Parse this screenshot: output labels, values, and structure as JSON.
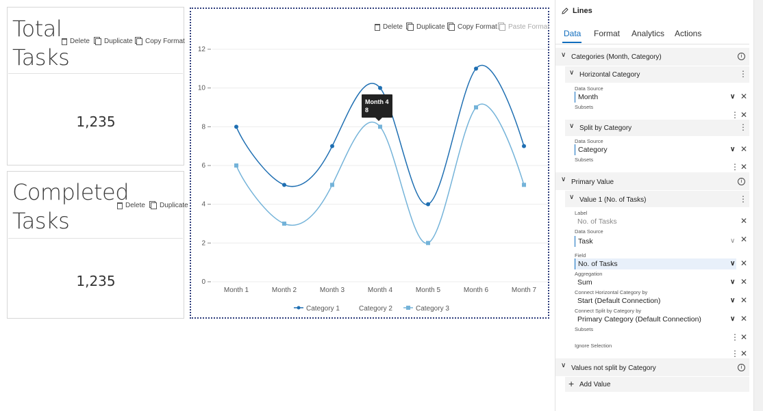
{
  "colors": {
    "accent": "#0f6cbd",
    "series1": "#1f6fb2",
    "series3": "#74b3d9"
  },
  "kpi1": {
    "title_line1": "Total",
    "title_line2": "Tasks",
    "value": "1,235"
  },
  "kpi2": {
    "title_line1": "Completed",
    "title_line2": "Tasks",
    "value": "1,235"
  },
  "toolbar": {
    "delete": "Delete",
    "duplicate": "Duplicate",
    "copy_format": "Copy Format",
    "paste_format": "Paste Format"
  },
  "chart_data": {
    "type": "line",
    "categories": [
      "Month 1",
      "Month 2",
      "Month 3",
      "Month 4",
      "Month 5",
      "Month 6",
      "Month 7"
    ],
    "ylim": [
      0,
      12
    ],
    "yticks": [
      "0",
      "2",
      "4",
      "6",
      "8",
      "10",
      "12"
    ],
    "series": [
      {
        "name": "Category 1",
        "values": [
          8,
          5,
          7,
          10,
          4,
          11,
          7
        ],
        "color": "#1f6fb2",
        "marker": "circle"
      },
      {
        "name": "Category 2",
        "values": [],
        "color": "#cccccc",
        "marker": "none"
      },
      {
        "name": "Category 3",
        "values": [
          6,
          3,
          5,
          8,
          2,
          9,
          5
        ],
        "color": "#74b3d9",
        "marker": "square"
      }
    ],
    "tooltip": {
      "line1": "Month 4",
      "line2": "8"
    },
    "smooth": true,
    "legend": "bottom"
  },
  "panel": {
    "title": "Lines",
    "tabs": [
      "Data",
      "Format",
      "Analytics",
      "Actions"
    ],
    "active_tab": "Data",
    "categories_header": "Categories (Month, Category)",
    "horizontal_category": "Horizontal Category",
    "hc_data_source_label": "Data Source",
    "hc_data_source": "Month",
    "hc_subsets_label": "Subsets",
    "split_by_category": "Split by Category",
    "sc_data_source_label": "Data Source",
    "sc_data_source": "Category",
    "sc_subsets_label": "Subsets",
    "primary_value": "Primary Value",
    "value1": "Value 1 (No. of Tasks)",
    "label_label": "Label",
    "label_placeholder": "No. of Tasks",
    "v_data_source_label": "Data Source",
    "v_data_source": "Task",
    "field_label": "Field",
    "field_value": "No. of Tasks",
    "aggregation_label": "Aggregation",
    "aggregation_value": "Sum",
    "connect_h_label": "Connect Horizontal Category by",
    "connect_h_value": "Start (Default Connection)",
    "connect_s_label": "Connect Split by Category by",
    "connect_s_value": "Primary Category (Default Connection)",
    "v_subsets_label": "Subsets",
    "ignore_selection_label": "Ignore Selection",
    "values_not_split": "Values not split by Category",
    "add_value": "Add Value"
  }
}
